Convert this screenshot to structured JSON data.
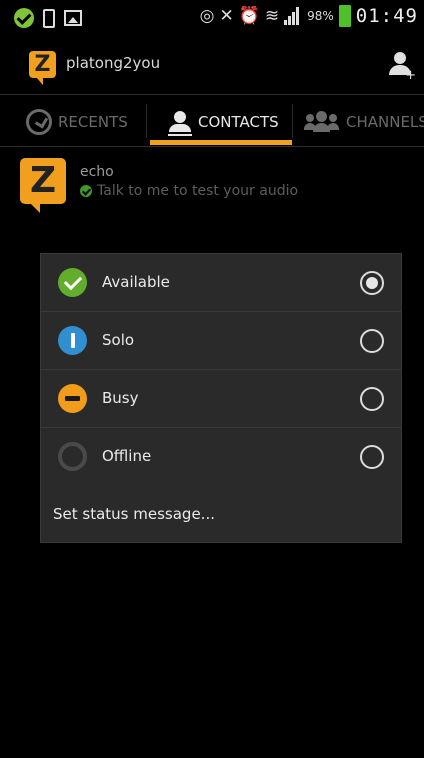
{
  "status_bar": {
    "battery_percent": "98%",
    "time": "01:49",
    "icons": [
      "check-circle-icon",
      "phone-icon",
      "image-icon",
      "eye-icon",
      "mute-icon",
      "alarm-icon",
      "wifi-icon",
      "signal-icon",
      "battery-icon"
    ]
  },
  "app": {
    "title": "platong2you",
    "logo_icon": "zello-logo-icon",
    "action_icon": "add-contact-icon"
  },
  "tabs": [
    {
      "label": "RECENTS",
      "icon": "clock-icon",
      "active": false
    },
    {
      "label": "CONTACTS",
      "icon": "person-icon",
      "active": true
    },
    {
      "label": "CHANNELS",
      "icon": "group-icon",
      "active": false
    }
  ],
  "contact": {
    "name": "echo",
    "status_message": "Talk to me to test your audio"
  },
  "status_dialog": {
    "options": [
      {
        "label": "Available",
        "icon": "available-check-icon",
        "selected": true
      },
      {
        "label": "Solo",
        "icon": "solo-icon",
        "selected": false
      },
      {
        "label": "Busy",
        "icon": "busy-icon",
        "selected": false
      },
      {
        "label": "Offline",
        "icon": "offline-icon",
        "selected": false
      }
    ],
    "set_status_message": "Set status message..."
  },
  "colors": {
    "accent": "#f0a01e",
    "available": "#62ad2b",
    "solo": "#2f8fd0",
    "busy": "#f19c1a",
    "dialog_bg": "#2a2a2a"
  }
}
